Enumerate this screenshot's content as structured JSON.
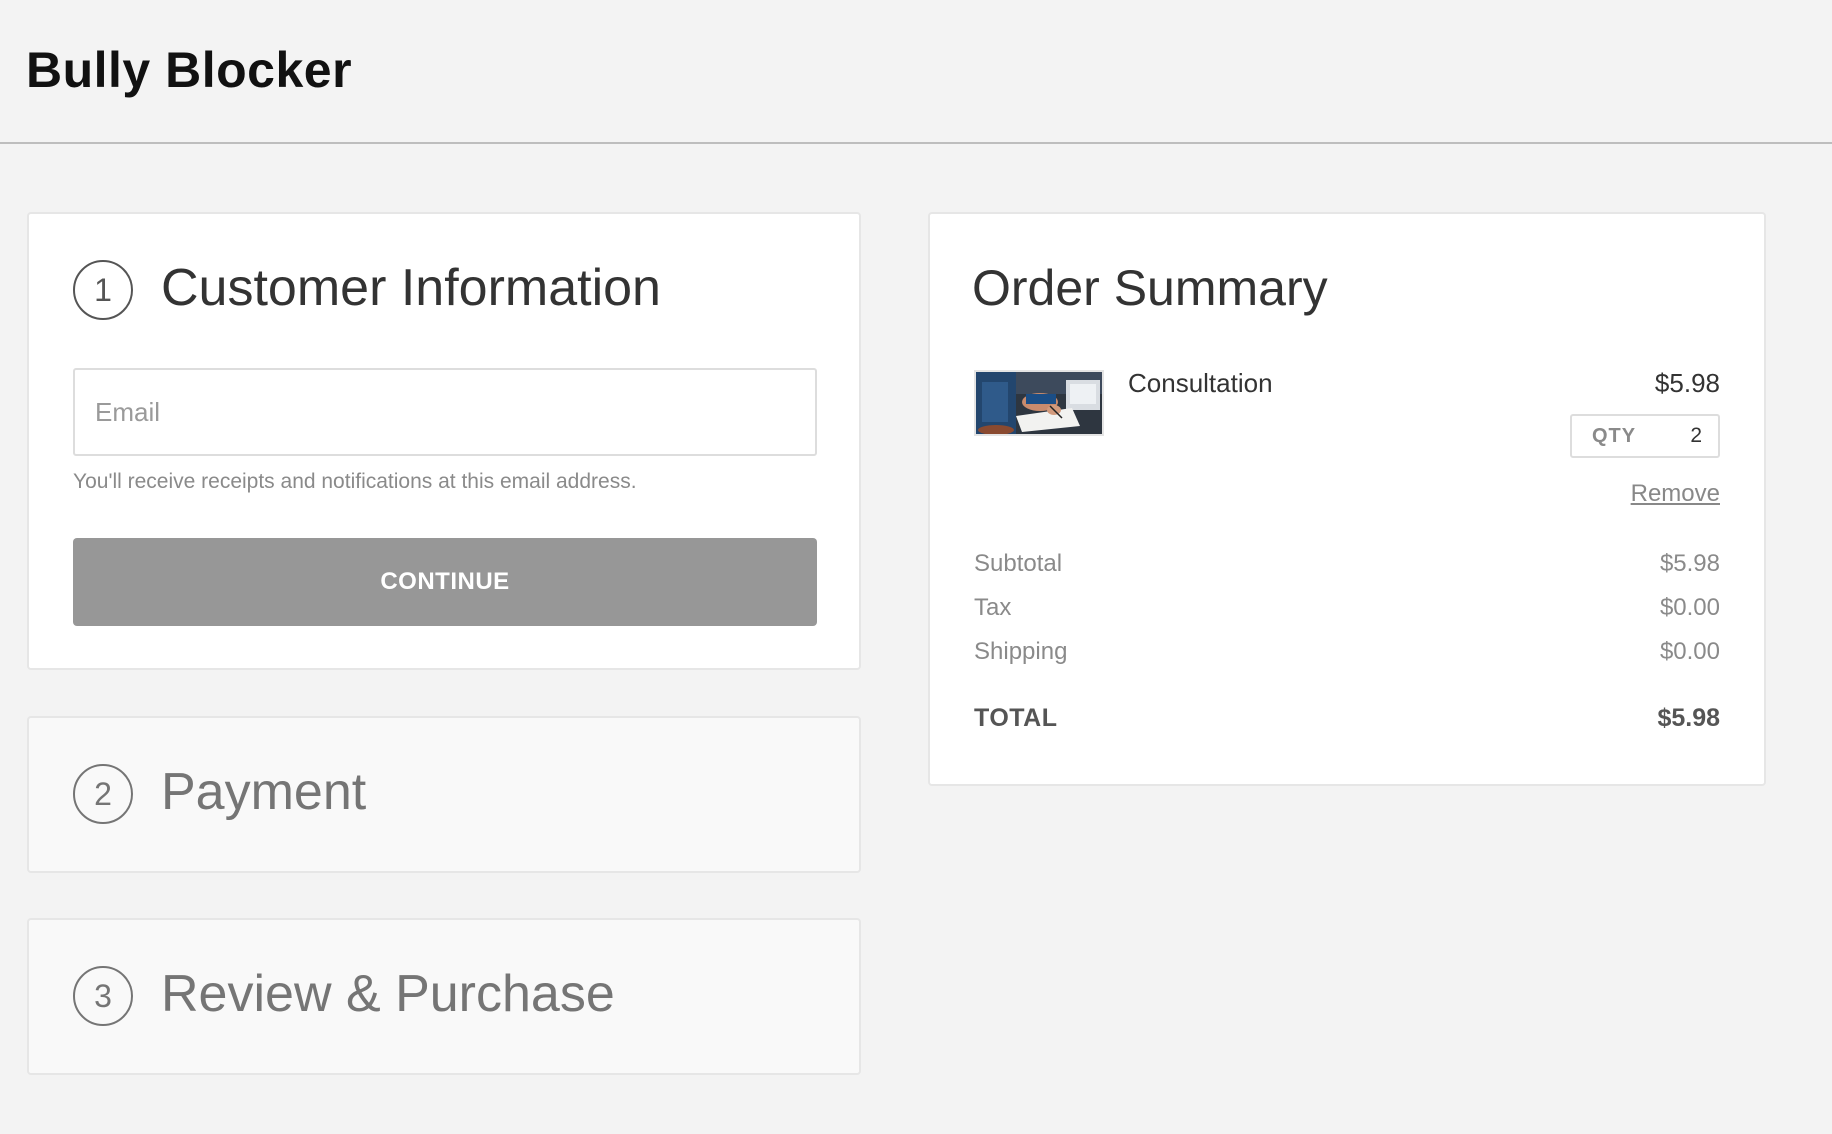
{
  "brand": "Bully Blocker",
  "steps": [
    {
      "number": "1",
      "title": "Customer Information"
    },
    {
      "number": "2",
      "title": "Payment"
    },
    {
      "number": "3",
      "title": "Review & Purchase"
    }
  ],
  "customer": {
    "email_placeholder": "Email",
    "email_value": "",
    "hint": "You'll receive receipts and notifications at this email address.",
    "continue_label": "CONTINUE"
  },
  "summary": {
    "title": "Order Summary",
    "item": {
      "name": "Consultation",
      "price": "$5.98",
      "qty_label": "QTY",
      "qty": "2",
      "remove_label": "Remove",
      "thumbnail": "product-photo"
    },
    "rows": [
      {
        "label": "Subtotal",
        "value": "$5.98"
      },
      {
        "label": "Tax",
        "value": "$0.00"
      },
      {
        "label": "Shipping",
        "value": "$0.00"
      }
    ],
    "total": {
      "label": "TOTAL",
      "value": "$5.98"
    }
  },
  "colors": {
    "background": "#f3f3f3",
    "button": "#979797",
    "card": "#ffffff",
    "collapsed_card": "#f9f9f9"
  }
}
